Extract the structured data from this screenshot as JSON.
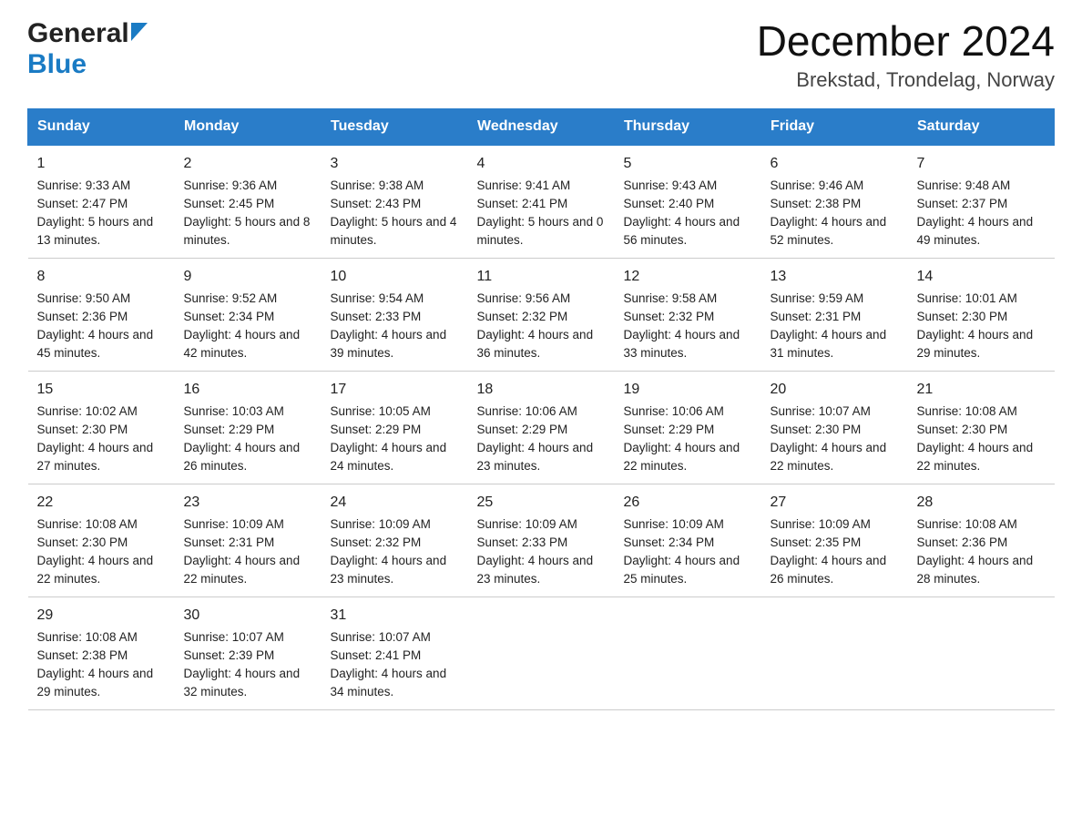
{
  "header": {
    "logo_general": "General",
    "logo_blue": "Blue",
    "title": "December 2024",
    "subtitle": "Brekstad, Trondelag, Norway"
  },
  "days_of_week": [
    "Sunday",
    "Monday",
    "Tuesday",
    "Wednesday",
    "Thursday",
    "Friday",
    "Saturday"
  ],
  "weeks": [
    [
      {
        "day": "1",
        "sunrise": "Sunrise: 9:33 AM",
        "sunset": "Sunset: 2:47 PM",
        "daylight": "Daylight: 5 hours and 13 minutes."
      },
      {
        "day": "2",
        "sunrise": "Sunrise: 9:36 AM",
        "sunset": "Sunset: 2:45 PM",
        "daylight": "Daylight: 5 hours and 8 minutes."
      },
      {
        "day": "3",
        "sunrise": "Sunrise: 9:38 AM",
        "sunset": "Sunset: 2:43 PM",
        "daylight": "Daylight: 5 hours and 4 minutes."
      },
      {
        "day": "4",
        "sunrise": "Sunrise: 9:41 AM",
        "sunset": "Sunset: 2:41 PM",
        "daylight": "Daylight: 5 hours and 0 minutes."
      },
      {
        "day": "5",
        "sunrise": "Sunrise: 9:43 AM",
        "sunset": "Sunset: 2:40 PM",
        "daylight": "Daylight: 4 hours and 56 minutes."
      },
      {
        "day": "6",
        "sunrise": "Sunrise: 9:46 AM",
        "sunset": "Sunset: 2:38 PM",
        "daylight": "Daylight: 4 hours and 52 minutes."
      },
      {
        "day": "7",
        "sunrise": "Sunrise: 9:48 AM",
        "sunset": "Sunset: 2:37 PM",
        "daylight": "Daylight: 4 hours and 49 minutes."
      }
    ],
    [
      {
        "day": "8",
        "sunrise": "Sunrise: 9:50 AM",
        "sunset": "Sunset: 2:36 PM",
        "daylight": "Daylight: 4 hours and 45 minutes."
      },
      {
        "day": "9",
        "sunrise": "Sunrise: 9:52 AM",
        "sunset": "Sunset: 2:34 PM",
        "daylight": "Daylight: 4 hours and 42 minutes."
      },
      {
        "day": "10",
        "sunrise": "Sunrise: 9:54 AM",
        "sunset": "Sunset: 2:33 PM",
        "daylight": "Daylight: 4 hours and 39 minutes."
      },
      {
        "day": "11",
        "sunrise": "Sunrise: 9:56 AM",
        "sunset": "Sunset: 2:32 PM",
        "daylight": "Daylight: 4 hours and 36 minutes."
      },
      {
        "day": "12",
        "sunrise": "Sunrise: 9:58 AM",
        "sunset": "Sunset: 2:32 PM",
        "daylight": "Daylight: 4 hours and 33 minutes."
      },
      {
        "day": "13",
        "sunrise": "Sunrise: 9:59 AM",
        "sunset": "Sunset: 2:31 PM",
        "daylight": "Daylight: 4 hours and 31 minutes."
      },
      {
        "day": "14",
        "sunrise": "Sunrise: 10:01 AM",
        "sunset": "Sunset: 2:30 PM",
        "daylight": "Daylight: 4 hours and 29 minutes."
      }
    ],
    [
      {
        "day": "15",
        "sunrise": "Sunrise: 10:02 AM",
        "sunset": "Sunset: 2:30 PM",
        "daylight": "Daylight: 4 hours and 27 minutes."
      },
      {
        "day": "16",
        "sunrise": "Sunrise: 10:03 AM",
        "sunset": "Sunset: 2:29 PM",
        "daylight": "Daylight: 4 hours and 26 minutes."
      },
      {
        "day": "17",
        "sunrise": "Sunrise: 10:05 AM",
        "sunset": "Sunset: 2:29 PM",
        "daylight": "Daylight: 4 hours and 24 minutes."
      },
      {
        "day": "18",
        "sunrise": "Sunrise: 10:06 AM",
        "sunset": "Sunset: 2:29 PM",
        "daylight": "Daylight: 4 hours and 23 minutes."
      },
      {
        "day": "19",
        "sunrise": "Sunrise: 10:06 AM",
        "sunset": "Sunset: 2:29 PM",
        "daylight": "Daylight: 4 hours and 22 minutes."
      },
      {
        "day": "20",
        "sunrise": "Sunrise: 10:07 AM",
        "sunset": "Sunset: 2:30 PM",
        "daylight": "Daylight: 4 hours and 22 minutes."
      },
      {
        "day": "21",
        "sunrise": "Sunrise: 10:08 AM",
        "sunset": "Sunset: 2:30 PM",
        "daylight": "Daylight: 4 hours and 22 minutes."
      }
    ],
    [
      {
        "day": "22",
        "sunrise": "Sunrise: 10:08 AM",
        "sunset": "Sunset: 2:30 PM",
        "daylight": "Daylight: 4 hours and 22 minutes."
      },
      {
        "day": "23",
        "sunrise": "Sunrise: 10:09 AM",
        "sunset": "Sunset: 2:31 PM",
        "daylight": "Daylight: 4 hours and 22 minutes."
      },
      {
        "day": "24",
        "sunrise": "Sunrise: 10:09 AM",
        "sunset": "Sunset: 2:32 PM",
        "daylight": "Daylight: 4 hours and 23 minutes."
      },
      {
        "day": "25",
        "sunrise": "Sunrise: 10:09 AM",
        "sunset": "Sunset: 2:33 PM",
        "daylight": "Daylight: 4 hours and 23 minutes."
      },
      {
        "day": "26",
        "sunrise": "Sunrise: 10:09 AM",
        "sunset": "Sunset: 2:34 PM",
        "daylight": "Daylight: 4 hours and 25 minutes."
      },
      {
        "day": "27",
        "sunrise": "Sunrise: 10:09 AM",
        "sunset": "Sunset: 2:35 PM",
        "daylight": "Daylight: 4 hours and 26 minutes."
      },
      {
        "day": "28",
        "sunrise": "Sunrise: 10:08 AM",
        "sunset": "Sunset: 2:36 PM",
        "daylight": "Daylight: 4 hours and 28 minutes."
      }
    ],
    [
      {
        "day": "29",
        "sunrise": "Sunrise: 10:08 AM",
        "sunset": "Sunset: 2:38 PM",
        "daylight": "Daylight: 4 hours and 29 minutes."
      },
      {
        "day": "30",
        "sunrise": "Sunrise: 10:07 AM",
        "sunset": "Sunset: 2:39 PM",
        "daylight": "Daylight: 4 hours and 32 minutes."
      },
      {
        "day": "31",
        "sunrise": "Sunrise: 10:07 AM",
        "sunset": "Sunset: 2:41 PM",
        "daylight": "Daylight: 4 hours and 34 minutes."
      },
      {
        "day": "",
        "sunrise": "",
        "sunset": "",
        "daylight": ""
      },
      {
        "day": "",
        "sunrise": "",
        "sunset": "",
        "daylight": ""
      },
      {
        "day": "",
        "sunrise": "",
        "sunset": "",
        "daylight": ""
      },
      {
        "day": "",
        "sunrise": "",
        "sunset": "",
        "daylight": ""
      }
    ]
  ]
}
